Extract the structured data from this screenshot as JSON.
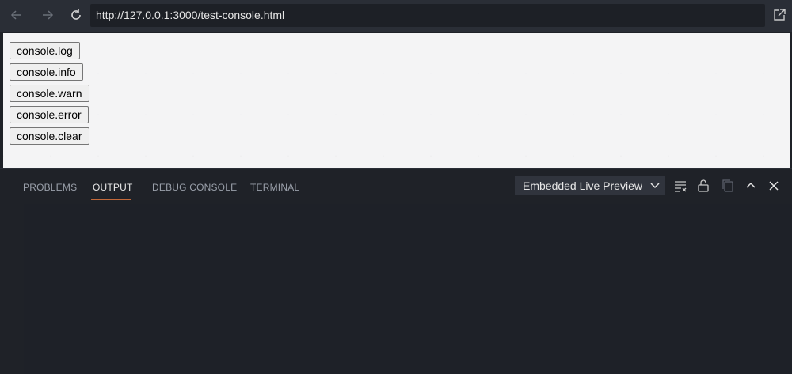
{
  "toolbar": {
    "url": "http://127.0.0.1:3000/test-console.html",
    "icons": [
      "back-icon",
      "forward-icon",
      "reload-icon",
      "open-external-icon"
    ]
  },
  "preview": {
    "buttons": [
      {
        "label": "console.log"
      },
      {
        "label": "console.info"
      },
      {
        "label": "console.warn"
      },
      {
        "label": "console.error"
      },
      {
        "label": "console.clear"
      }
    ]
  },
  "panel": {
    "tabs": [
      {
        "label": "PROBLEMS",
        "active": false
      },
      {
        "label": "OUTPUT",
        "active": true
      },
      {
        "label": "DEBUG CONSOLE",
        "active": false
      },
      {
        "label": "TERMINAL",
        "active": false
      }
    ],
    "output_channel": "Embedded Live Preview",
    "icons": [
      "clear-output-icon",
      "lock-icon",
      "copy-icon",
      "maximize-icon",
      "close-icon"
    ]
  },
  "colors": {
    "accent_underline": "#c3693a",
    "panel_bg": "#1f2228",
    "toolbar_bg": "#2a2e36"
  }
}
